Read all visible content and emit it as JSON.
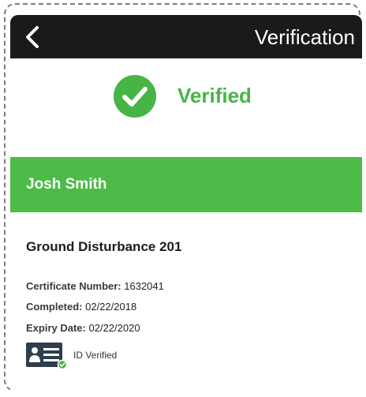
{
  "header": {
    "title": "Verification",
    "back_icon": "chevron-left-icon"
  },
  "status": {
    "label": "Verified",
    "icon": "check-circle-icon",
    "color": "#46b545"
  },
  "holder": {
    "name": "Josh Smith",
    "band_color": "#4cbb47"
  },
  "certificate": {
    "course": "Ground Disturbance 201",
    "fields": [
      {
        "label": "Certificate Number:",
        "value": "1632041"
      },
      {
        "label": "Completed:",
        "value": "02/22/2018"
      },
      {
        "label": "Expiry Date:",
        "value": "02/22/2020"
      }
    ],
    "id_status": {
      "label": "ID Verified",
      "icon": "id-card-verified-icon"
    }
  }
}
